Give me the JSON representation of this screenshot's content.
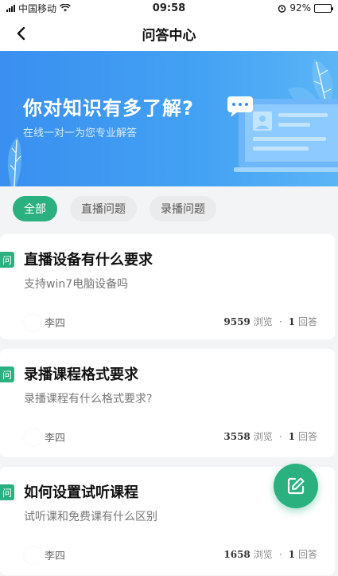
{
  "status_bar": {
    "carrier": "中国移动",
    "time": "09:58",
    "battery": "92%",
    "battery_level": 0.92
  },
  "nav": {
    "title": "问答中心"
  },
  "banner": {
    "title": "你对知识有多了解?",
    "subtitle": "在线一对一为您专业解答"
  },
  "filters": [
    {
      "label": "全部",
      "active": true
    },
    {
      "label": "直播问题",
      "active": false
    },
    {
      "label": "录播问题",
      "active": false
    }
  ],
  "questions": [
    {
      "badge": "问",
      "title": "直播设备有什么要求",
      "desc": "支持win7电脑设备吗",
      "author": "李四",
      "views": "9559",
      "views_label": "浏览",
      "sep": "·",
      "answers": "1",
      "answers_label": "回答"
    },
    {
      "badge": "问",
      "title": "录播课程格式要求",
      "desc": "录播课程有什么格式要求?",
      "author": "李四",
      "views": "3558",
      "views_label": "浏览",
      "sep": "·",
      "answers": "1",
      "answers_label": "回答"
    },
    {
      "badge": "问",
      "title": "如何设置试听课程",
      "desc": "试听课和免费课有什么区别",
      "author": "李四",
      "views": "1658",
      "views_label": "浏览",
      "sep": "·",
      "answers": "1",
      "answers_label": "回答"
    }
  ],
  "colors": {
    "accent": "#2bb07f",
    "banner": "#3a8ff0"
  },
  "icons": {
    "back": "chevron-left-icon",
    "compose": "edit-icon"
  }
}
